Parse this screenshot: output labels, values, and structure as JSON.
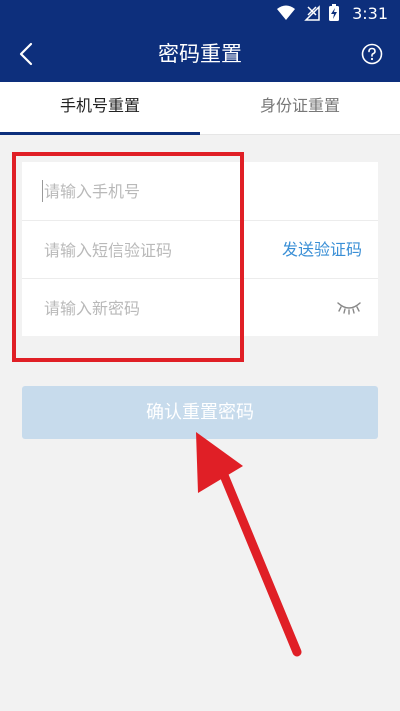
{
  "status_bar": {
    "time": "3:31",
    "icons": [
      "wifi-icon",
      "signal-icon",
      "battery-charging-icon"
    ]
  },
  "header": {
    "title": "密码重置",
    "back_icon": "chevron-left-icon",
    "help_icon": "help-circle-icon"
  },
  "tabs": [
    {
      "label": "手机号重置",
      "active": true
    },
    {
      "label": "身份证重置",
      "active": false
    }
  ],
  "form": {
    "phone_placeholder": "请输入手机号",
    "code_placeholder": "请输入短信验证码",
    "send_code_label": "发送验证码",
    "password_placeholder": "请输入新密码",
    "password_toggle_icon": "eye-closed-icon"
  },
  "submit_label": "确认重置密码",
  "colors": {
    "header_bg": "#0d2f7c",
    "link": "#3a8fd6",
    "button_disabled": "#c7dbec",
    "annotation": "#e01f26"
  }
}
